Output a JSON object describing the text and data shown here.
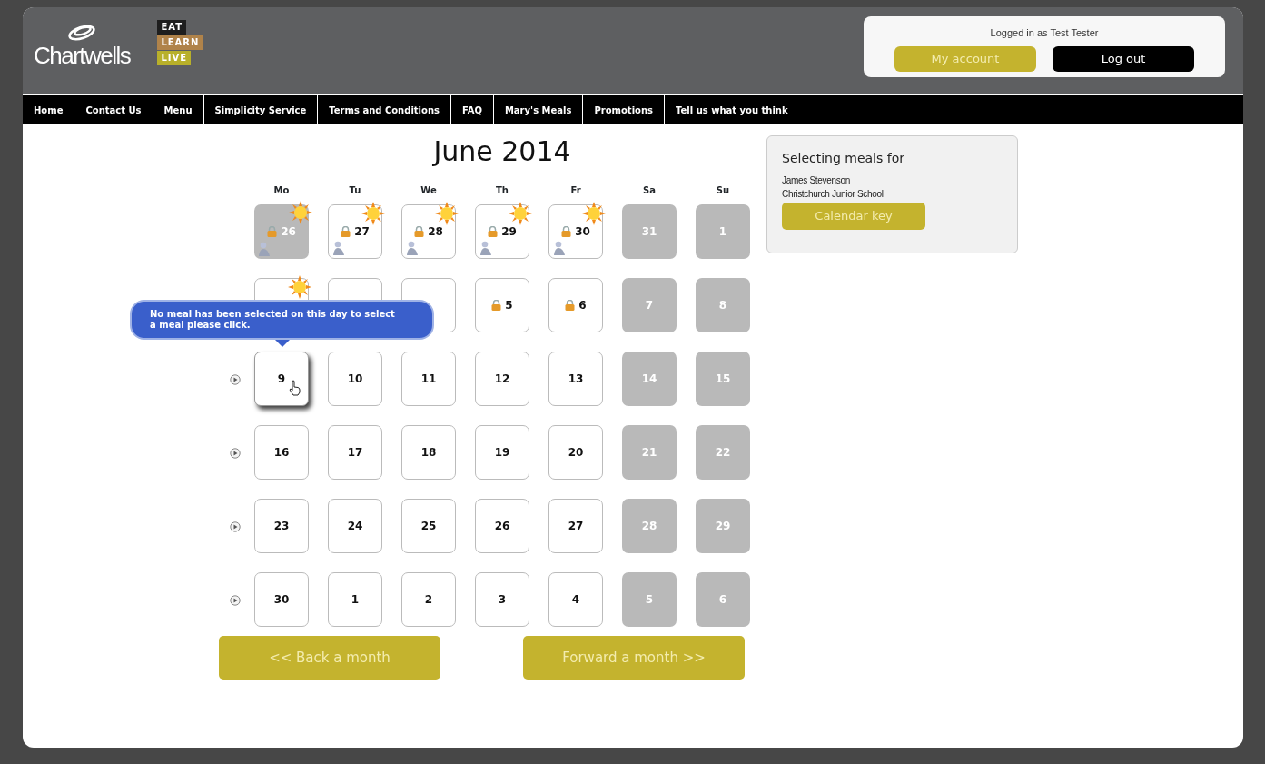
{
  "header": {
    "logo": "Chartwells",
    "tagline": [
      {
        "label": "EAT",
        "color": "#1e1e1e"
      },
      {
        "label": "LEARN",
        "color": "#b0834a"
      },
      {
        "label": "LIVE",
        "color": "#b8b02a"
      }
    ],
    "login": {
      "text": "Logged in as Test Tester",
      "buttons": [
        {
          "label": "My account",
          "kind": "primary"
        },
        {
          "label": "Log out",
          "kind": "dark"
        }
      ]
    }
  },
  "nav": [
    "Home",
    "Contact Us",
    "Menu",
    "Simplicity Service",
    "Terms and Conditions",
    "FAQ",
    "Mary's Meals",
    "Promotions",
    "Tell us what you think"
  ],
  "calendar": {
    "title": "June 2014",
    "weekdays": [
      "Mo",
      "Tu",
      "We",
      "Th",
      "Fr",
      "Sa",
      "Su"
    ],
    "weeks": [
      {
        "arrow": false,
        "days": [
          {
            "day": "26",
            "kind": "past",
            "locked": true,
            "sun": true,
            "figure": true,
            "hovered": false
          },
          {
            "day": "27",
            "kind": "open",
            "locked": true,
            "sun": true,
            "figure": true,
            "hovered": false
          },
          {
            "day": "28",
            "kind": "open",
            "locked": true,
            "sun": true,
            "figure": true,
            "hovered": false
          },
          {
            "day": "29",
            "kind": "open",
            "locked": true,
            "sun": true,
            "figure": true,
            "hovered": false
          },
          {
            "day": "30",
            "kind": "open",
            "locked": true,
            "sun": true,
            "figure": true,
            "hovered": false
          },
          {
            "day": "31",
            "kind": "weekend",
            "locked": false,
            "sun": false,
            "figure": false,
            "hovered": false
          },
          {
            "day": "1",
            "kind": "weekend",
            "locked": false,
            "sun": false,
            "figure": false,
            "hovered": false
          }
        ]
      },
      {
        "arrow": false,
        "days": [
          {
            "kind": "open",
            "sun": true,
            "hovered": false
          },
          {
            "kind": "open",
            "hovered": false
          },
          {
            "kind": "open",
            "hovered": false
          },
          {
            "day": "5",
            "kind": "open",
            "locked": true,
            "sun": false,
            "figure": false,
            "hovered": false
          },
          {
            "day": "6",
            "kind": "open",
            "locked": true,
            "sun": false,
            "figure": false,
            "hovered": false
          },
          {
            "day": "7",
            "kind": "weekend",
            "locked": false,
            "sun": false,
            "figure": false,
            "hovered": false
          },
          {
            "day": "8",
            "kind": "weekend",
            "locked": false,
            "sun": false,
            "figure": false,
            "hovered": false
          }
        ]
      },
      {
        "arrow": true,
        "days": [
          {
            "day": "9",
            "kind": "open",
            "locked": false,
            "sun": false,
            "figure": false,
            "hovered": true
          },
          {
            "day": "10",
            "kind": "open",
            "locked": false,
            "sun": false,
            "figure": false,
            "hovered": false
          },
          {
            "day": "11",
            "kind": "open",
            "locked": false,
            "sun": false,
            "figure": false,
            "hovered": false
          },
          {
            "day": "12",
            "kind": "open",
            "locked": false,
            "sun": false,
            "figure": false,
            "hovered": false
          },
          {
            "day": "13",
            "kind": "open",
            "locked": false,
            "sun": false,
            "figure": false,
            "hovered": false
          },
          {
            "day": "14",
            "kind": "weekend",
            "locked": false,
            "sun": false,
            "figure": false,
            "hovered": false
          },
          {
            "day": "15",
            "kind": "weekend",
            "locked": false,
            "sun": false,
            "figure": false,
            "hovered": false
          }
        ]
      },
      {
        "arrow": true,
        "days": [
          {
            "day": "16",
            "kind": "open",
            "locked": false,
            "sun": false,
            "figure": false,
            "hovered": false
          },
          {
            "day": "17",
            "kind": "open",
            "locked": false,
            "sun": false,
            "figure": false,
            "hovered": false
          },
          {
            "day": "18",
            "kind": "open",
            "locked": false,
            "sun": false,
            "figure": false,
            "hovered": false
          },
          {
            "day": "19",
            "kind": "open",
            "locked": false,
            "sun": false,
            "figure": false,
            "hovered": false
          },
          {
            "day": "20",
            "kind": "open",
            "locked": false,
            "sun": false,
            "figure": false,
            "hovered": false
          },
          {
            "day": "21",
            "kind": "weekend",
            "locked": false,
            "sun": false,
            "figure": false,
            "hovered": false
          },
          {
            "day": "22",
            "kind": "weekend",
            "locked": false,
            "sun": false,
            "figure": false,
            "hovered": false
          }
        ]
      },
      {
        "arrow": true,
        "days": [
          {
            "day": "23",
            "kind": "open",
            "locked": false,
            "sun": false,
            "figure": false,
            "hovered": false
          },
          {
            "day": "24",
            "kind": "open",
            "locked": false,
            "sun": false,
            "figure": false,
            "hovered": false
          },
          {
            "day": "25",
            "kind": "open",
            "locked": false,
            "sun": false,
            "figure": false,
            "hovered": false
          },
          {
            "day": "26",
            "kind": "open",
            "locked": false,
            "sun": false,
            "figure": false,
            "hovered": false
          },
          {
            "day": "27",
            "kind": "open",
            "locked": false,
            "sun": false,
            "figure": false,
            "hovered": false
          },
          {
            "day": "28",
            "kind": "weekend",
            "locked": false,
            "sun": false,
            "figure": false,
            "hovered": false
          },
          {
            "day": "29",
            "kind": "weekend",
            "locked": false,
            "sun": false,
            "figure": false,
            "hovered": false
          }
        ]
      },
      {
        "arrow": true,
        "days": [
          {
            "day": "30",
            "kind": "open",
            "locked": false,
            "sun": false,
            "figure": false,
            "hovered": false
          },
          {
            "day": "1",
            "kind": "open",
            "locked": false,
            "sun": false,
            "figure": false,
            "hovered": false
          },
          {
            "day": "2",
            "kind": "open",
            "locked": false,
            "sun": false,
            "figure": false,
            "hovered": false
          },
          {
            "day": "3",
            "kind": "open",
            "locked": false,
            "sun": false,
            "figure": false,
            "hovered": false
          },
          {
            "day": "4",
            "kind": "open",
            "locked": false,
            "sun": false,
            "figure": false,
            "hovered": false
          },
          {
            "day": "5",
            "kind": "weekend",
            "locked": false,
            "sun": false,
            "figure": false,
            "hovered": false
          },
          {
            "day": "6",
            "kind": "weekend",
            "locked": false,
            "sun": false,
            "figure": false,
            "hovered": false
          }
        ]
      }
    ],
    "tooltip": "No meal has been selected on this day to select a meal please click.",
    "back": "<< Back a month",
    "forward": "Forward a month >>"
  },
  "side": {
    "heading": "Selecting meals for",
    "name": "James Stevenson",
    "school": "Christchurch Junior School",
    "button": "Calendar key"
  }
}
